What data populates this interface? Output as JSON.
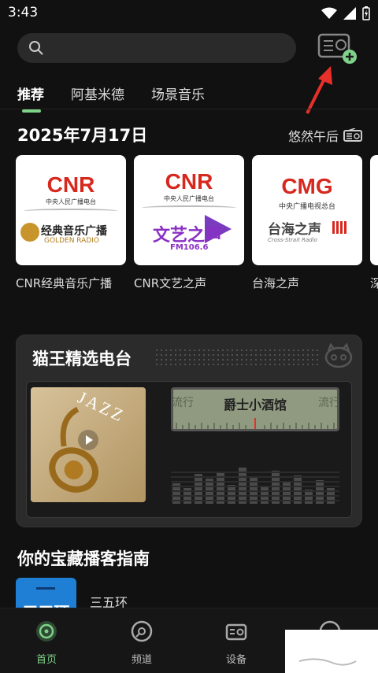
{
  "status": {
    "time": "3:43"
  },
  "tabs": [
    {
      "label": "推荐"
    },
    {
      "label": "阿基米德"
    },
    {
      "label": "场景音乐"
    }
  ],
  "date_row": {
    "date": "2025年7月17日",
    "mood": "悠然午后"
  },
  "stations": [
    {
      "name": "CNR经典音乐广播",
      "logo_top": "CNR",
      "logo_sub": "中央人民广播电台",
      "logo_main": "经典音乐广播",
      "logo_en": "GOLDEN RADIO"
    },
    {
      "name": "CNR文艺之声",
      "logo_top": "CNR",
      "logo_sub": "中央人民广播电台",
      "logo_main": "文艺之声",
      "logo_en": "FM106.6"
    },
    {
      "name": "台海之声",
      "logo_top": "CMG",
      "logo_sub": "中央广播电视总台",
      "logo_main": "台海之声",
      "logo_en": "Cross-Strait Radio"
    },
    {
      "name": "深"
    }
  ],
  "panel": {
    "title": "猫王精选电台",
    "station": "爵士小酒馆",
    "left_label": "流行",
    "right_label": "流行",
    "cover_text": "JAZZ"
  },
  "section": {
    "title": "你的宝藏播客指南"
  },
  "podcast": {
    "name": "三五环",
    "cover_text": "三五环"
  },
  "nav": [
    {
      "label": "首页"
    },
    {
      "label": "频道"
    },
    {
      "label": "设备"
    }
  ],
  "colors": {
    "accent": "#7fd28a",
    "background": "#111111",
    "arrow": "#e8302a"
  }
}
